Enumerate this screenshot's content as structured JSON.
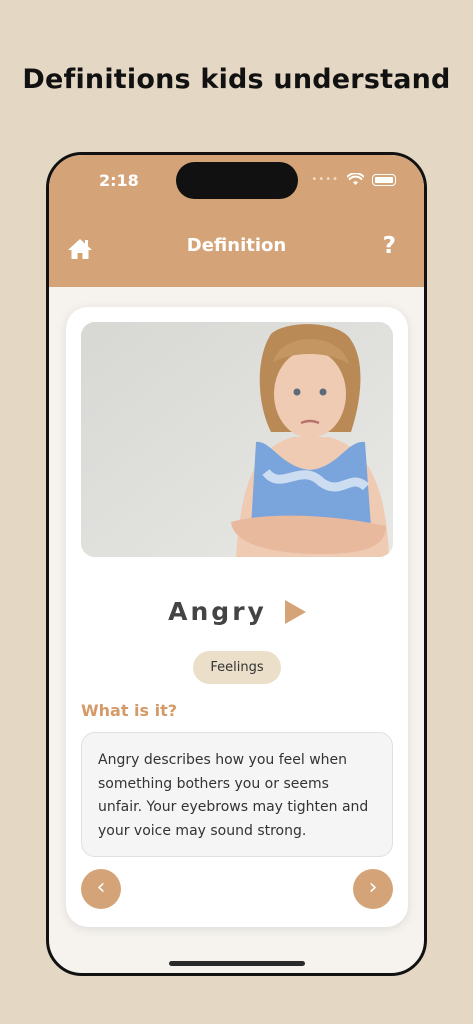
{
  "headline": "Definitions kids understand",
  "status_bar": {
    "time": "2:18",
    "dots": "••••"
  },
  "nav": {
    "title": "Definition",
    "help": "?"
  },
  "word": {
    "text": "Angry"
  },
  "category": {
    "label": "Feelings"
  },
  "definition": {
    "heading": "What is it?",
    "text": "Angry describes how you feel when something bothers you or seems unfair. Your eyebrows may tighten and your voice may sound strong."
  },
  "navigation": {
    "prev_glyph": "‹",
    "next_glyph": "›"
  },
  "colors": {
    "accent": "#d4a478",
    "background": "#e4d8c4",
    "tag": "#ebdfc9",
    "heading": "#d49a68"
  },
  "icons": [
    "home-icon",
    "wifi-icon",
    "battery-icon",
    "play-icon",
    "chevron-left-icon",
    "chevron-right-icon"
  ]
}
